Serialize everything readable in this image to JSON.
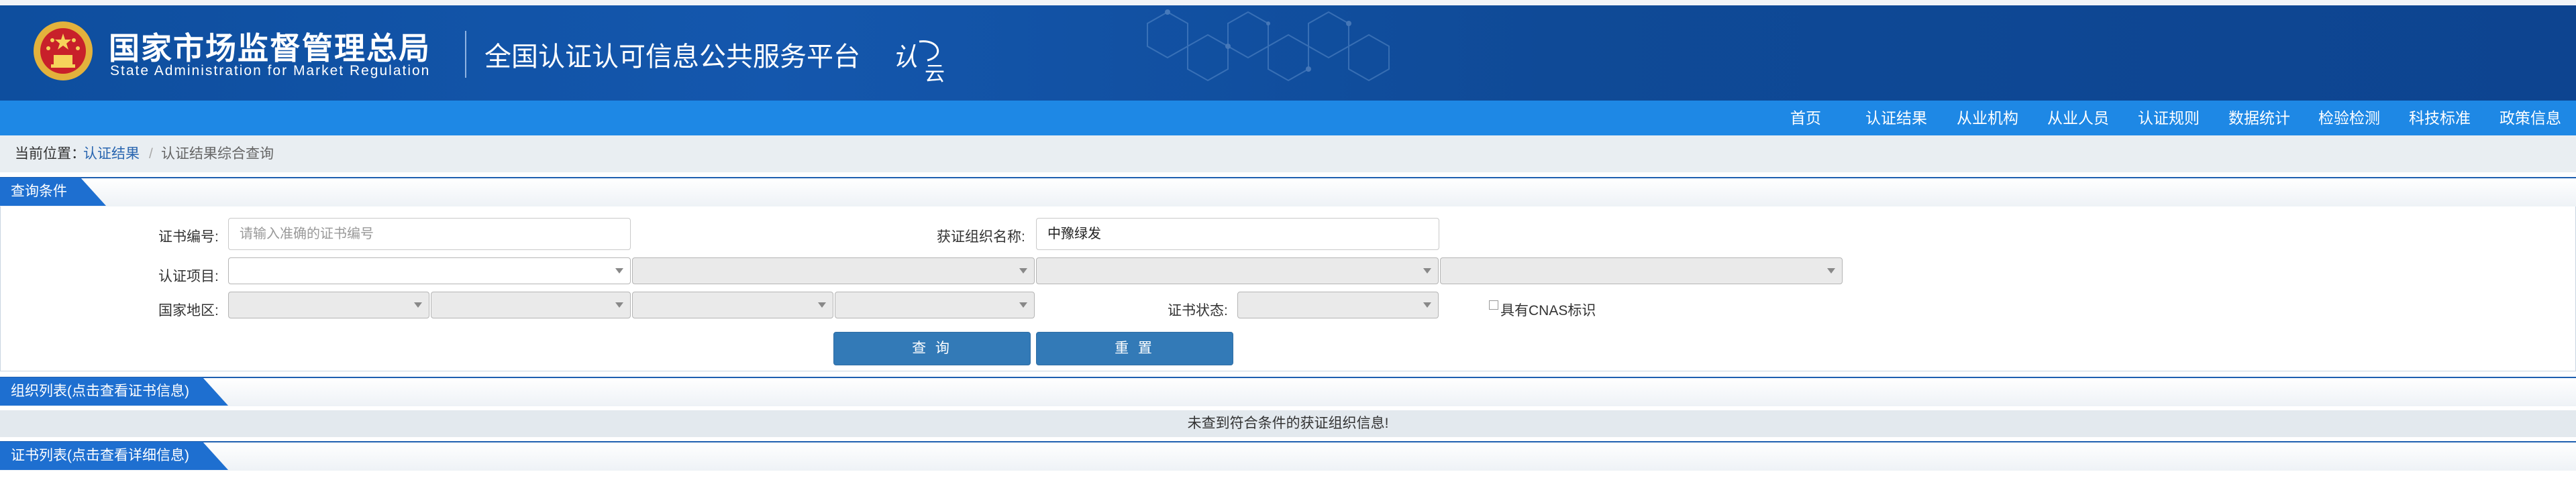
{
  "header": {
    "org_cn": "国家市场监督管理总局",
    "org_en": "State Administration  for  Market Regulation",
    "platform": "全国认证认可信息公共服务平台",
    "logo_text_1": "认",
    "logo_text_2": "云"
  },
  "nav": {
    "items": [
      "首页",
      "认证结果",
      "从业机构",
      "从业人员",
      "认证规则",
      "数据统计",
      "检验检测",
      "科技标准",
      "政策信息"
    ]
  },
  "breadcrumb": {
    "label": "当前位置：",
    "link": "认证结果",
    "separator": "/",
    "current": "认证结果综合查询"
  },
  "query": {
    "tab": "查询条件",
    "cert_no_label": "证书编号:",
    "cert_no_placeholder": "请输入准确的证书编号",
    "org_name_label": "获证组织名称:",
    "org_name_value": "中豫绿发",
    "project_label": "认证项目:",
    "region_label": "国家地区:",
    "status_label": "证书状态:",
    "cnas_label": "具有CNAS标识",
    "search_button": "查 询",
    "reset_button": "重 置"
  },
  "org_list": {
    "tab": "组织列表(点击查看证书信息)",
    "empty_message": "未查到符合条件的获证组织信息!"
  },
  "cert_list": {
    "tab": "证书列表(点击查看详细信息)"
  },
  "colors": {
    "banner": "#1457ad",
    "navbar": "#1e88e5",
    "tab": "#1e6fd0",
    "button": "#337ab7"
  }
}
